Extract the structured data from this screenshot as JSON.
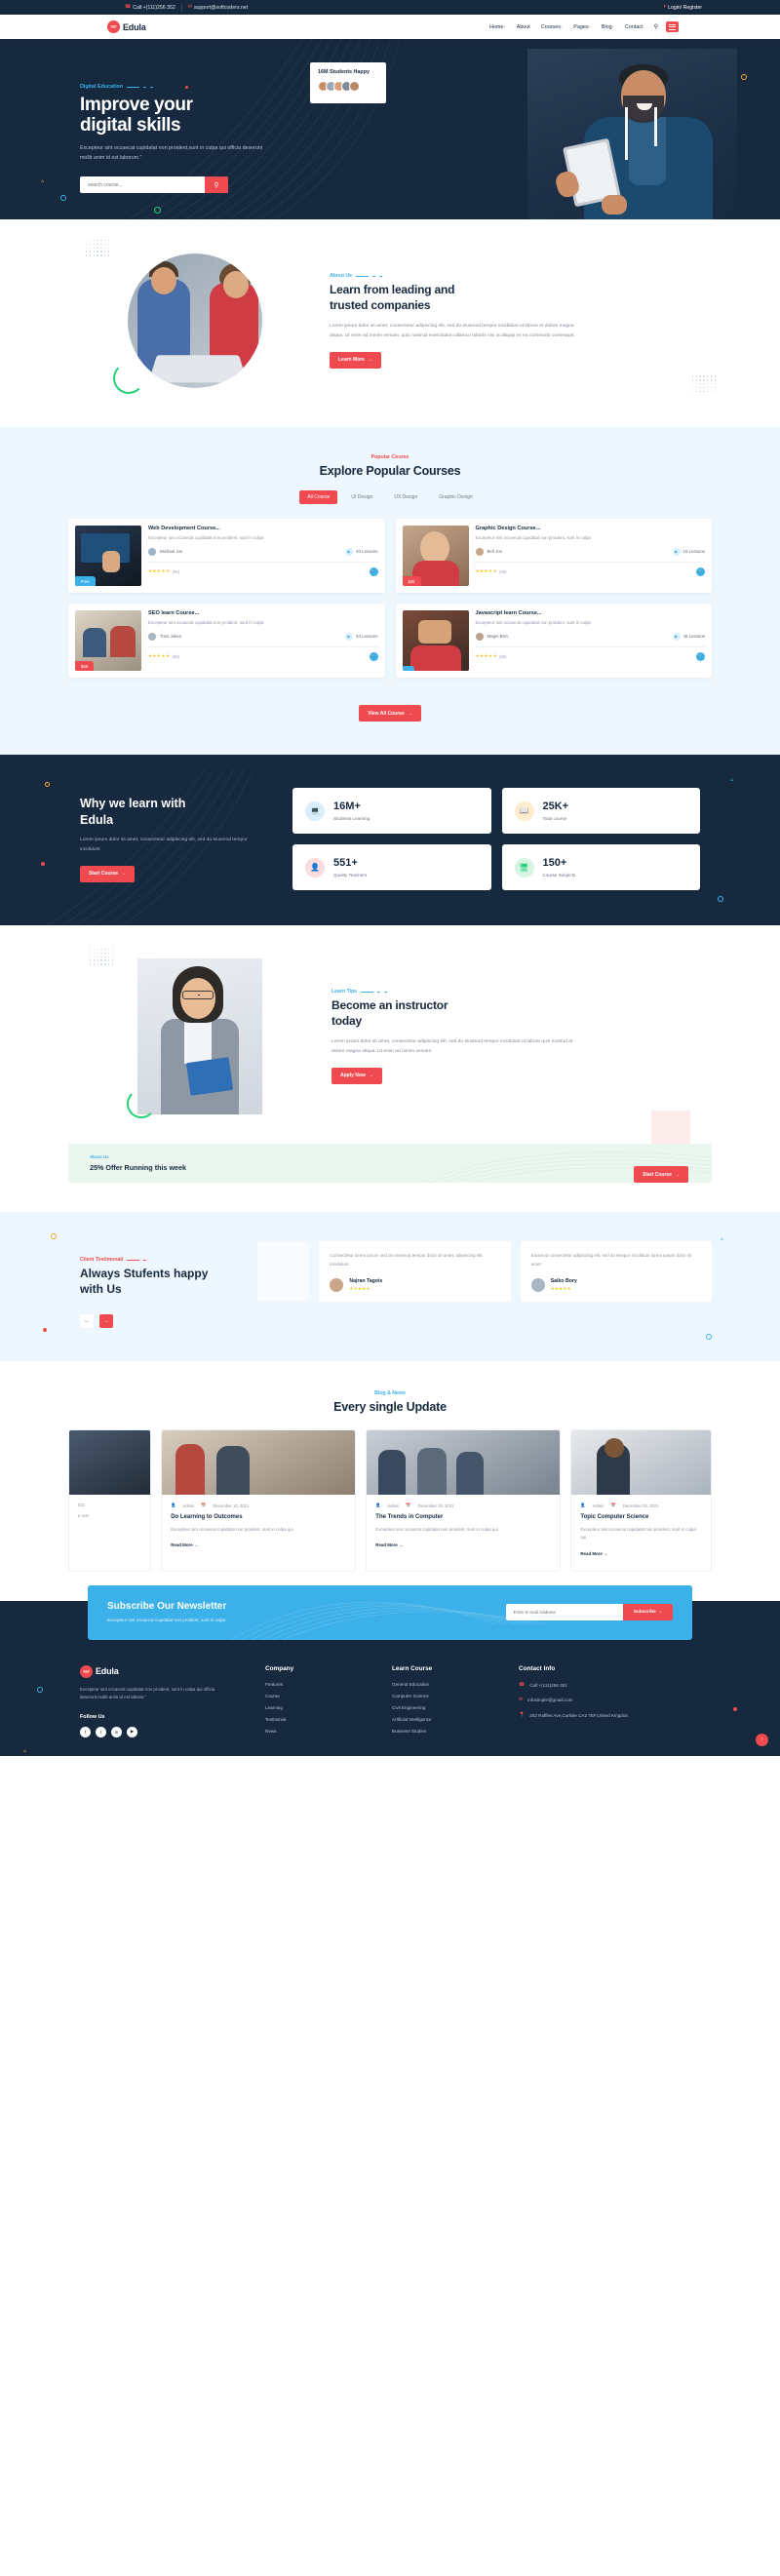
{
  "topbar": {
    "phone": "Call:+(111)256 352",
    "email": "support@softcoders.net",
    "login": "Login/ Register"
  },
  "nav": {
    "brand": "Edula",
    "items": [
      {
        "label": "Home",
        "caret": "+"
      },
      {
        "label": "About",
        "caret": ""
      },
      {
        "label": "Courses",
        "caret": "+"
      },
      {
        "label": "Pages",
        "caret": "+"
      },
      {
        "label": "Blog",
        "caret": "+"
      },
      {
        "label": "Contact",
        "caret": ""
      }
    ]
  },
  "hero": {
    "eyebrow": "Digital Education",
    "title_line1": "Improve your",
    "title_line2": "digital skills",
    "paragraph": "Excepteur sint occaecat cupidatat non proident,sunt in culpa qui officia deserunt mollit anim id est laborum.\"",
    "search_placeholder": "search course...",
    "badge_title": "16M Students Happy"
  },
  "about": {
    "eyebrow": "About Us",
    "title_line1": "Learn from leading and",
    "title_line2": "trusted companies",
    "paragraph": "Lorem ipsum dolor sit amet, consectetur adipiscing elit, sed do eiusmod tempor incididunt ut labore et dolore magna aliqua. Ut enim ad minim veniam, quis nostrud exercitation ullamco laboris nisi ut aliquip ex ea commodo consequat.",
    "button": "Learn More"
  },
  "courses": {
    "eyebrow": "Popular Course",
    "title": "Explore Popular Courses",
    "tabs": [
      "All Course",
      "UI Design",
      "UX Design",
      "Graphic Design"
    ],
    "active_tab": "All Course",
    "view_all": "View All Course",
    "items": [
      {
        "title": "Web Development Course...",
        "desc": "Excepteur sint occaecat cupidatat non proident, sunt in culpa",
        "author": "Michael Joe",
        "lessons": "40 Lessons",
        "badge": "Free",
        "badge_color": "#3cb0e8",
        "rating": "★★★★★",
        "reviews": "(05)"
      },
      {
        "title": "Graphic Design Course...",
        "desc": "Excepteur sint occaecat cupidatat non proident, sunt in culpa",
        "author": "Bell Jori",
        "lessons": "18 Lessons",
        "badge": "$25",
        "badge_color": "#ef4a4f",
        "rating": "★★★★★",
        "reviews": "(05)"
      },
      {
        "title": "SEO learn Course...",
        "desc": "Excepteur sint occaecat cupidatat non proident, sunt in culpa",
        "author": "Toris Jokes",
        "lessons": "34 Lessons",
        "badge": "$49",
        "badge_color": "#ef4a4f",
        "rating": "★★★★★",
        "reviews": "(05)"
      },
      {
        "title": "Javascript learn Course...",
        "desc": "Excepteur sint occaecat cupidatat non proident, sunt in culpa",
        "author": "Magni Bert",
        "lessons": "46 Lessons",
        "badge": "",
        "badge_color": "#3cb0e8",
        "rating": "★★★★★",
        "reviews": "(05)"
      }
    ]
  },
  "why": {
    "title_line1": "Why we learn with",
    "title_line2": "Edula",
    "paragraph": "Lorem ipsum dolor sit amet, consectetur adipiscing elit, sed do eiusmod tempor incididunt",
    "button": "Start Course",
    "stats": [
      {
        "number": "16M+",
        "label": "Students Learning",
        "icon": "laptop-icon",
        "glyph": "ὋB",
        "bg": "#d9eefb",
        "fg": "#3cb0e8"
      },
      {
        "number": "25K+",
        "label": "Total course",
        "icon": "book-icon",
        "glyph": "Ὅ6",
        "bg": "#fdeccd",
        "fg": "#f0a92c"
      },
      {
        "number": "551+",
        "label": "Quality Teachers",
        "icon": "teacher-icon",
        "glyph": "὆4",
        "bg": "#fbdbdd",
        "fg": "#ef4a4f"
      },
      {
        "number": "150+",
        "label": "Course Subjects",
        "icon": "monitor-icon",
        "glyph": "὚5",
        "bg": "#d7f3e2",
        "fg": "#25d07a"
      }
    ]
  },
  "instructor": {
    "eyebrow": "Learn Tips",
    "title_line1": "Become an instructor",
    "title_line2": "today",
    "paragraph": "Lorem ipsum dolor sit amet, consectetur adipiscing elit, sed do eiusmod tempor incididunt ut labore quis nostrud at dolore magna aliqua. Ut enim ad minim veniam.",
    "button": "Apply Now"
  },
  "offer": {
    "eyebrow": "About Us",
    "title": "25% Offer Running this week",
    "button": "Start Course"
  },
  "testimonial": {
    "eyebrow": "Client Testimonail",
    "title_line1": "Always Stufents happy",
    "title_line2": "with Us",
    "items": [
      {
        "quote": "Consectetur lorem ipsum sed do eiusmod tempor dolor sit amet, adipiscing elit, incididunt",
        "name": "Najran Tagois",
        "stars": "★★★★★"
      },
      {
        "quote": "Eiusmod consectetur adipiscing elit, sed do tempor incididunt lorem ipsum dolor sit amet",
        "name": "Saiko Bory",
        "stars": "★★★★★"
      }
    ]
  },
  "blog": {
    "eyebrow": "Blog & News",
    "title": "Every single Update",
    "posts": [
      {
        "author": "Admin",
        "date": "December 10, 2021",
        "title": "Do Learning to Outcomes",
        "desc": "Excepteur sint occaecat cupidatat non proident, sunt in culpa qui",
        "more": "Read More"
      },
      {
        "author": "Admin",
        "date": "December 15, 2021",
        "title": "The Trends in Computer",
        "desc": "Excepteur sint occaecat cupidatat non proident, sunt in culpa qui",
        "more": "Read More"
      },
      {
        "author": "Admin",
        "date": "December 05, 2021",
        "title": "Topic Computer Science",
        "desc": "Excepteur sint occaecat cupidatat non proident, sunt in culpa qui",
        "more": "Read More"
      }
    ]
  },
  "newsletter": {
    "title": "Subscribe Our Newsletter",
    "paragraph": "Excepteur sint occaecat cupidatat non proident, sunt in culpa",
    "placeholder": "Enter E-mail Address",
    "button": "Subscribe"
  },
  "footer": {
    "brand": "Edula",
    "about": "Excepteur sint occaecat cupidatat non proident, sunt in culpa qui officia deserunt mollit anim id est laboris.\"",
    "follow_title": "Follow Us",
    "social": [
      "f",
      "t",
      "in",
      "▶"
    ],
    "company": {
      "title": "Company",
      "items": [
        "Features",
        "Course",
        "Learning",
        "Testiminial",
        "News"
      ]
    },
    "learn": {
      "title": "Learn Course",
      "items": [
        "General Education",
        "Computer Science",
        "Civil Engineering",
        "Artificial Intelligence",
        "Business Studies"
      ]
    },
    "contact": {
      "title": "Contact Info",
      "phone": "Call:+(111)256 352",
      "email": "infosimple@gmail.com",
      "address": "202 Raffles Ave,Carlisle CA2 7EF,United Kingdon"
    }
  },
  "colors": {
    "navy": "#17293f",
    "red": "#ef4a4f",
    "blue": "#3cb0e8",
    "light_blue_bg": "#eef7fd",
    "green": "#25d07a",
    "yellow": "#fbbf24"
  }
}
